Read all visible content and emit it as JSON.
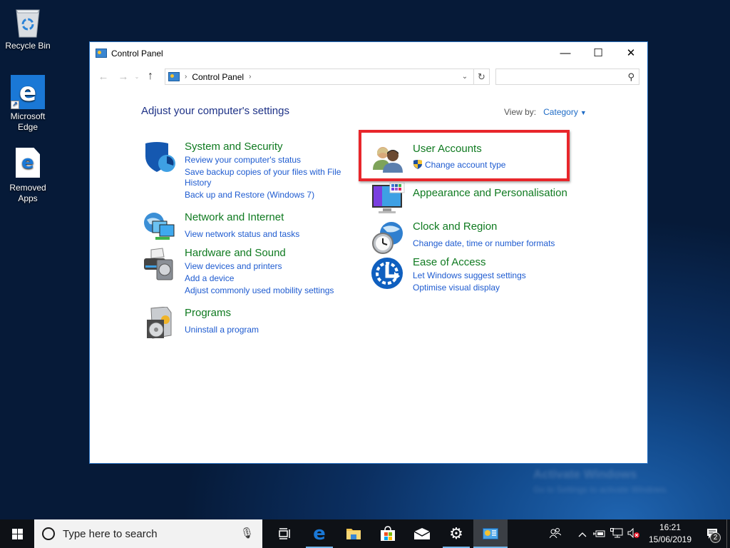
{
  "desktop": {
    "icons": [
      {
        "label": "Recycle Bin",
        "icon": "recycle-bin-icon"
      },
      {
        "label_line1": "Microsoft",
        "label_line2": "Edge",
        "icon": "edge-icon"
      },
      {
        "label_line1": "Removed",
        "label_line2": "Apps",
        "icon": "document-edge-icon"
      }
    ],
    "watermark": {
      "line1": "Activate Windows",
      "line2": "Go to Settings to activate Windows."
    }
  },
  "window": {
    "title": "Control Panel",
    "controls": {
      "minimize": "—",
      "maximize": "☐",
      "close": "✕"
    },
    "nav": {
      "back": "←",
      "forward": "→",
      "recent": "⌄",
      "up": "↑"
    },
    "address": {
      "breadcrumb": [
        "Control Panel"
      ],
      "separator": "›",
      "dropdown": "⌄",
      "refresh": "↻"
    },
    "search": {
      "placeholder": "",
      "value": "",
      "icon": "⚲"
    },
    "heading": "Adjust your computer's settings",
    "view_by": {
      "label": "View by:",
      "value": "Category",
      "arrow": "▼"
    },
    "categories": [
      {
        "title": "System and Security",
        "links": [
          "Review your computer's status",
          "Save backup copies of your files with File",
          "History",
          "Back up and Restore (Windows 7)"
        ]
      },
      {
        "title": "Network and Internet",
        "links": [
          "View network status and tasks"
        ]
      },
      {
        "title": "Hardware and Sound",
        "links": [
          "View devices and printers",
          "Add a device",
          "Adjust commonly used mobility settings"
        ]
      },
      {
        "title": "Programs",
        "links": [
          "Uninstall a program"
        ]
      },
      {
        "title": "User Accounts",
        "links": [
          "Change account type"
        ],
        "highlighted": true
      },
      {
        "title": "Appearance and Personalisation",
        "links": []
      },
      {
        "title": "Clock and Region",
        "links": [
          "Change date, time or number formats"
        ]
      },
      {
        "title": "Ease of Access",
        "links": [
          "Let Windows suggest settings",
          "Optimise visual display"
        ]
      }
    ],
    "highlight_color": "#e8262b"
  },
  "taskbar": {
    "search_placeholder": "Type here to search",
    "apps": [
      {
        "name": "task-view",
        "glyph": "⧉"
      },
      {
        "name": "edge",
        "glyph": "e"
      },
      {
        "name": "file-explorer",
        "glyph": ""
      },
      {
        "name": "store",
        "glyph": ""
      },
      {
        "name": "mail",
        "glyph": "✉"
      },
      {
        "name": "settings",
        "glyph": "⚙"
      },
      {
        "name": "control-panel",
        "glyph": ""
      }
    ],
    "tray": {
      "people": "⚇",
      "chevron": "^",
      "time": "16:21",
      "date": "15/06/2019",
      "notifications_count": "2"
    }
  }
}
